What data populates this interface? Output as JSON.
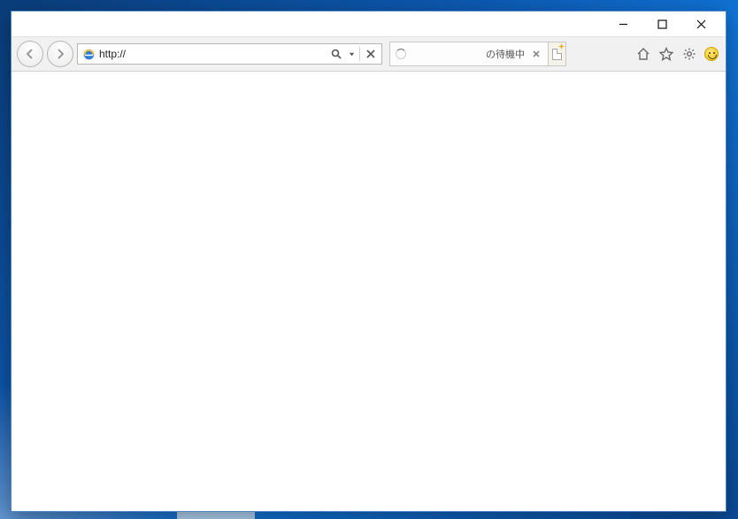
{
  "window": {
    "controls": {
      "minimize": "minimize",
      "maximize": "maximize",
      "close": "close"
    }
  },
  "nav": {
    "back_enabled": false,
    "forward_enabled": false
  },
  "address": {
    "value": "http://"
  },
  "tabs": [
    {
      "label": "の待機中",
      "loading": true
    }
  ],
  "toolbar_icons": {
    "home": "home",
    "favorites": "favorites",
    "tools": "tools",
    "feedback": "feedback"
  }
}
